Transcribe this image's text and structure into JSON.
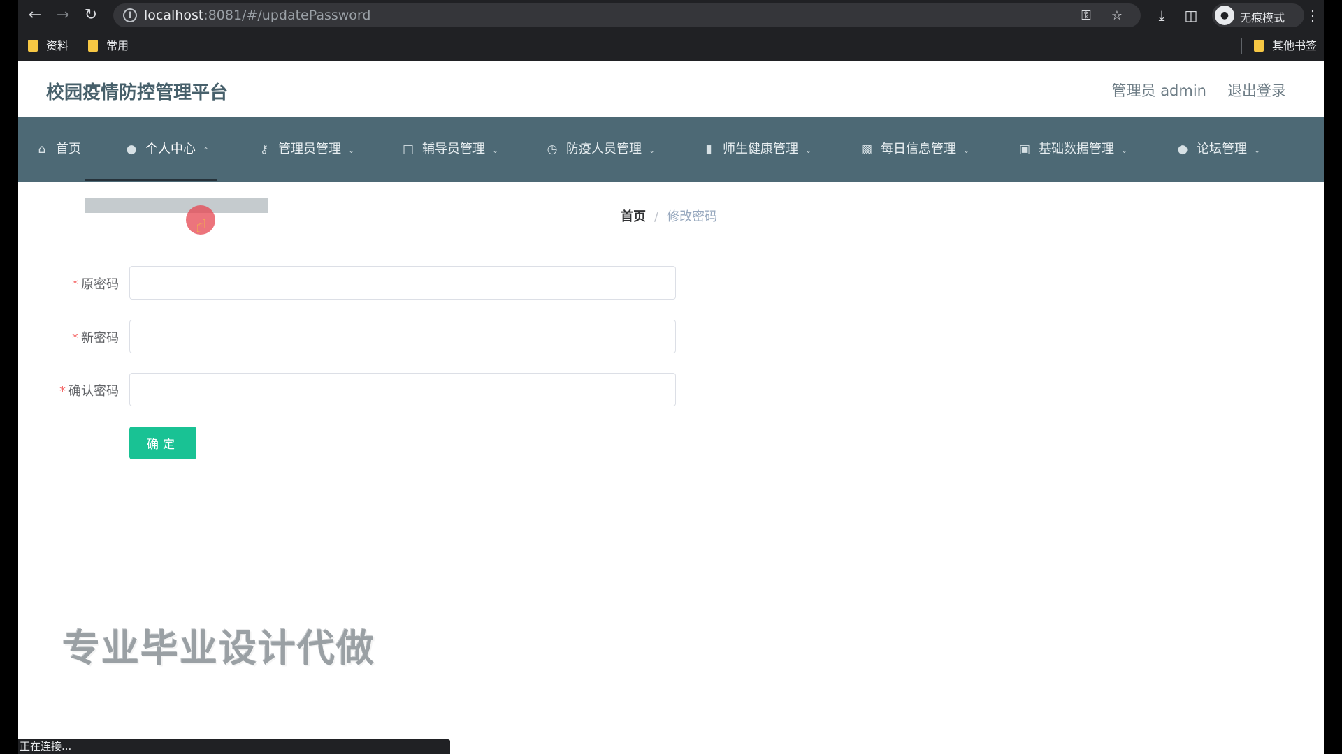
{
  "browser": {
    "url_host": "localhost",
    "url_rest": ":8081/#/updatePassword",
    "incognito_label": "无痕模式",
    "bookmarks": [
      "资料",
      "常用"
    ],
    "other_bookmarks": "其他书签"
  },
  "header": {
    "title": "校园疫情防控管理平台",
    "user": "管理员 admin",
    "logout": "退出登录"
  },
  "menu": {
    "items": [
      {
        "label": "首页",
        "icon": "home-icon"
      },
      {
        "label": "个人中心",
        "icon": "user-icon"
      },
      {
        "label": "管理员管理",
        "icon": "mic-icon"
      },
      {
        "label": "辅导员管理",
        "icon": "crop-icon"
      },
      {
        "label": "防疫人员管理",
        "icon": "compass-icon"
      },
      {
        "label": "师生健康管理",
        "icon": "thermometer-icon"
      },
      {
        "label": "每日信息管理",
        "icon": "briefcase-icon"
      },
      {
        "label": "基础数据管理",
        "icon": "chart-icon"
      },
      {
        "label": "论坛管理",
        "icon": "user-icon"
      }
    ]
  },
  "breadcrumb": {
    "home": "首页",
    "separator": "/",
    "current": "修改密码"
  },
  "form": {
    "old_password_label": "原密码",
    "new_password_label": "新密码",
    "confirm_password_label": "确认密码",
    "required_mark": "*",
    "submit_label": "确定"
  },
  "watermark": "专业毕业设计代做",
  "status_bar": "正在连接..."
}
